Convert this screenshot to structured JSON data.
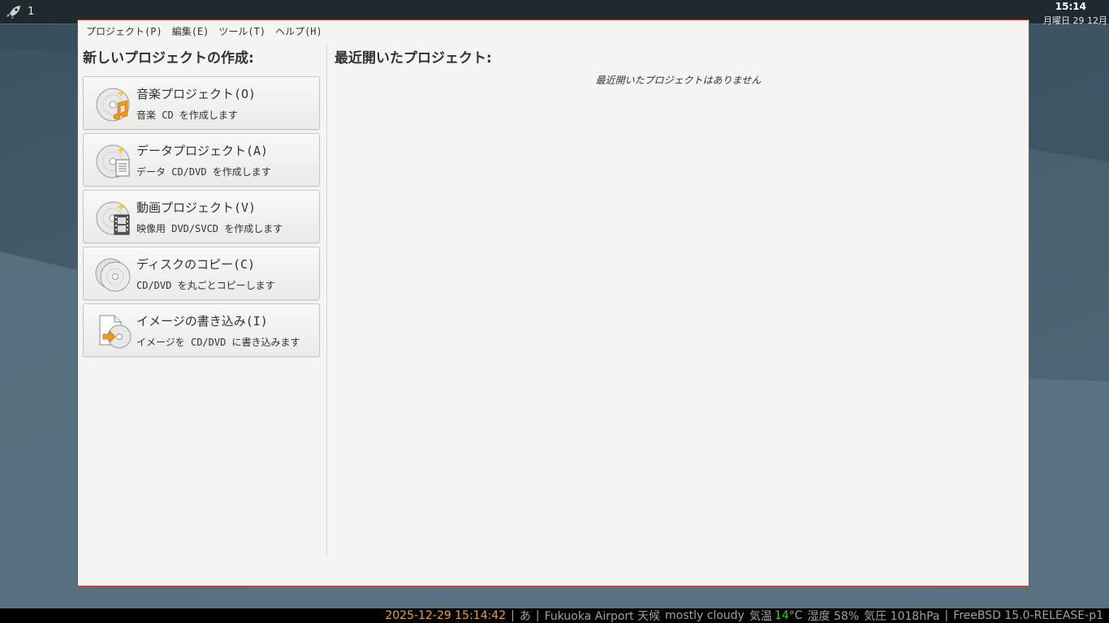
{
  "panel": {
    "workspace": "1",
    "clock": "15:14",
    "date": "月曜日 29 12月"
  },
  "menu": {
    "items": [
      "プロジェクト(P)",
      "編集(E)",
      "ツール(T)",
      "ヘルプ(H)"
    ]
  },
  "new_project": {
    "heading": "新しいプロジェクトの作成:",
    "actions": [
      {
        "title": "音楽プロジェクト(O)",
        "desc": "音楽 CD を作成します",
        "icon": "audio-cd-icon"
      },
      {
        "title": "データプロジェクト(A)",
        "desc": "データ CD/DVD を作成します",
        "icon": "data-disc-icon"
      },
      {
        "title": "動画プロジェクト(V)",
        "desc": "映像用 DVD/SVCD を作成します",
        "icon": "video-disc-icon"
      },
      {
        "title": "ディスクのコピー(C)",
        "desc": "CD/DVD を丸ごとコピーします",
        "icon": "disc-copy-icon"
      },
      {
        "title": "イメージの書き込み(I)",
        "desc": "イメージを CD/DVD に書き込みます",
        "icon": "burn-image-icon"
      }
    ]
  },
  "recent": {
    "heading": "最近開いたプロジェクト:",
    "empty_message": "最近開いたプロジェクトはありません"
  },
  "status_bar": {
    "datetime": "2025-12-29 15:14:42",
    "sep": "|",
    "ime": "あ",
    "weather_location": "Fukuoka Airport 天候",
    "weather_desc": "mostly cloudy",
    "temp_label": "気温",
    "temp_value": "14",
    "temp_unit": "°C",
    "humidity": "湿度 58%",
    "pressure": "気圧 1018hPa",
    "os": "FreeBSD 15.0-RELEASE-p1"
  },
  "colors": {
    "window_border": "#c0392b",
    "status_datetime": "#f0a030",
    "status_temp": "#3ec43e"
  }
}
